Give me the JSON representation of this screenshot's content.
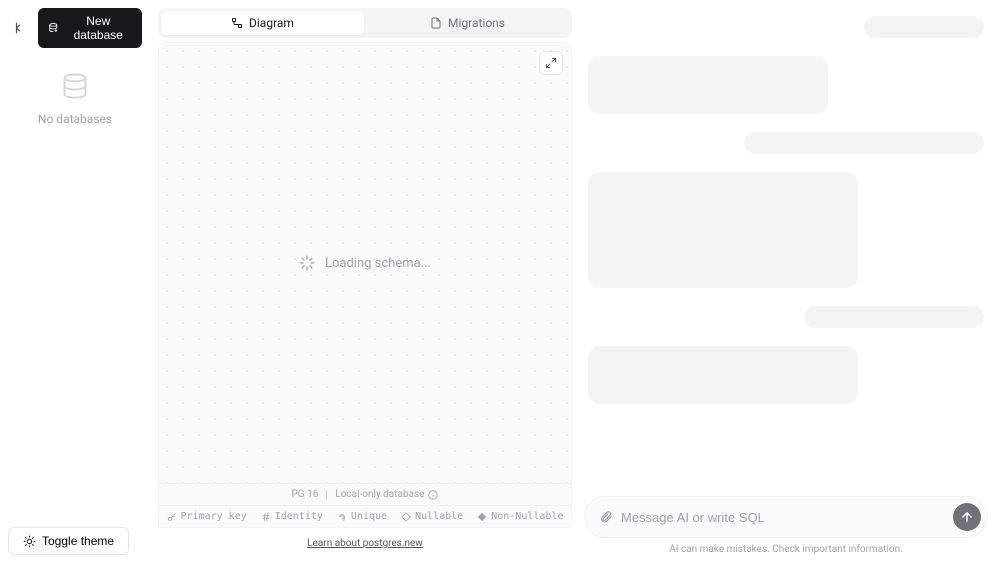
{
  "sidebar": {
    "new_database_label": "New database",
    "empty_state": "No databases",
    "toggle_theme_label": "Toggle theme"
  },
  "tabs": {
    "diagram": "Diagram",
    "migrations": "Migrations"
  },
  "diagram": {
    "loading_text": "Loading schema..."
  },
  "status": {
    "pg_version": "PG 16",
    "db_scope": "Local-only database"
  },
  "legend": {
    "primary_key": "Primary key",
    "identity": "Identity",
    "unique": "Unique",
    "nullable": "Nullable",
    "non_nullable": "Non-Nullable"
  },
  "footer": {
    "learn_link": "Learn about postgres.new"
  },
  "chat": {
    "placeholder": "Message AI or write SQL",
    "disclaimer": "AI can make mistakes. Check important information."
  }
}
